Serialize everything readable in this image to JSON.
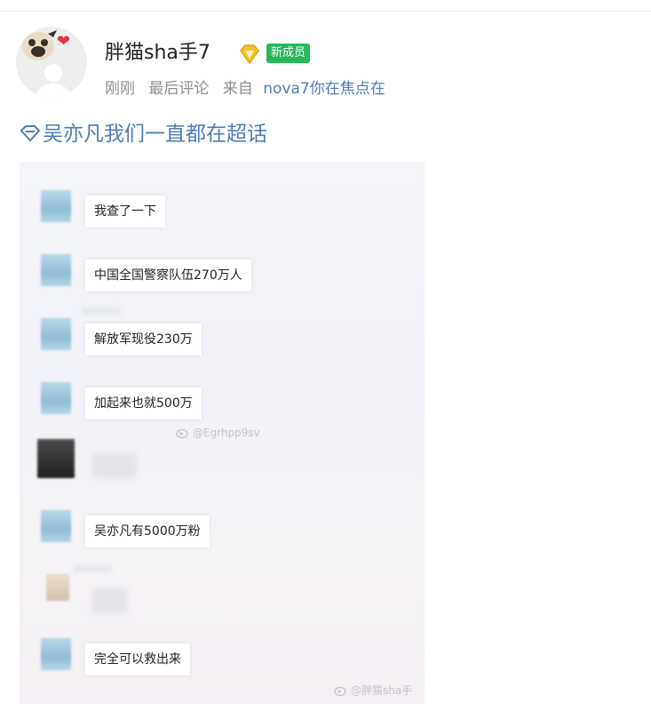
{
  "post": {
    "username": "胖猫sha手7",
    "badge": "新成员",
    "meta": {
      "time": "刚刚",
      "status": "最后评论",
      "source_prefix": "来自",
      "source": "nova7你在焦点在"
    },
    "topic": "吴亦凡我们一直都在超话"
  },
  "screenshot": {
    "messages": [
      {
        "text": "我查了一下"
      },
      {
        "text": "中国全国警察队伍270万人"
      },
      {
        "text": "解放军现役230万"
      },
      {
        "text": "加起来也就500万"
      },
      {
        "text": "吴亦凡有5000万粉"
      },
      {
        "text": "完全可以救出来"
      }
    ],
    "watermark_1": "@Egrhpp9sv",
    "watermark_2": "@胖猫sha手"
  },
  "colors": {
    "link": "#4f7db8",
    "badge": "#29b65c",
    "heart": "#e03545"
  },
  "icons": [
    "pug-avatar",
    "heart-icon",
    "vip-diamond-icon",
    "topic-diamond-icon",
    "weibo-watermark-icon"
  ]
}
